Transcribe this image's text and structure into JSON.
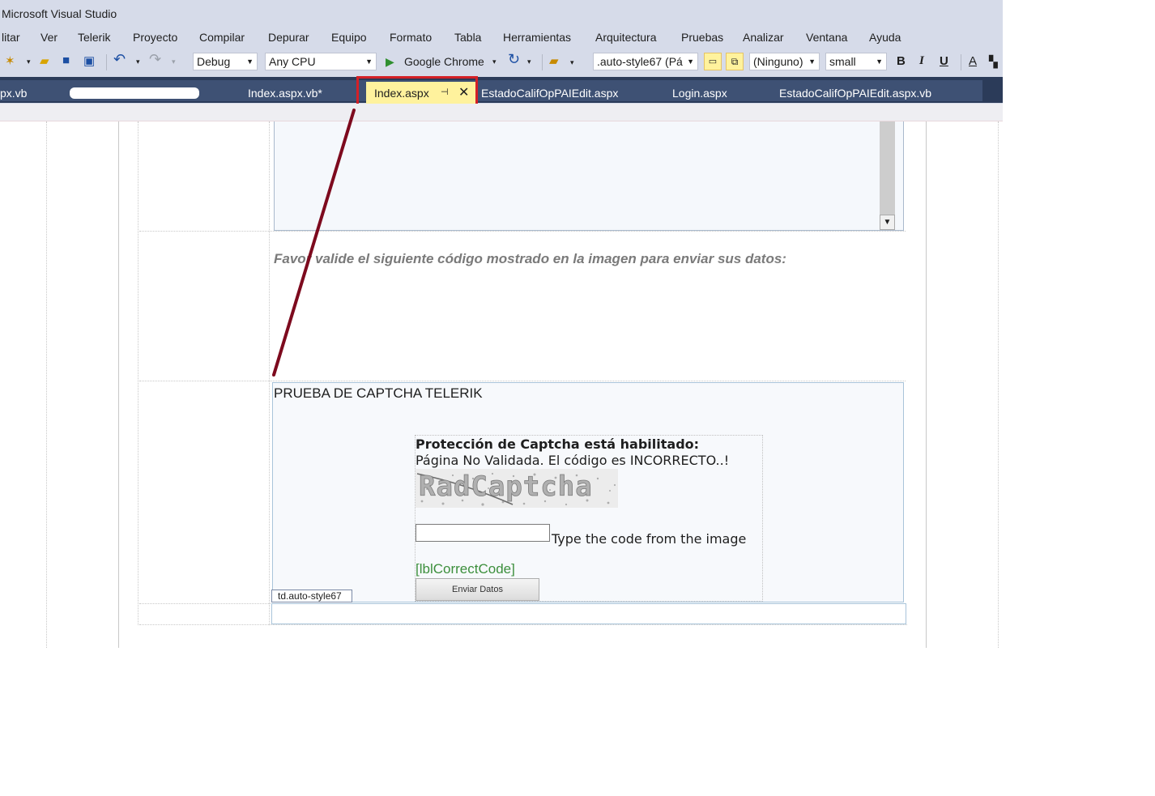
{
  "window": {
    "title": "Microsoft Visual Studio"
  },
  "menu": [
    "litar",
    "Ver",
    "Telerik",
    "Proyecto",
    "Compilar",
    "Depurar",
    "Equipo",
    "Formato",
    "Tabla",
    "Herramientas",
    "Arquitectura",
    "Pruebas",
    "Analizar",
    "Ventana",
    "Ayuda"
  ],
  "toolbar": {
    "config": "Debug",
    "platform": "Any CPU",
    "run_target": "Google Chrome",
    "style_target": ".auto-style67 (Pá",
    "font_name": "(Ninguno)",
    "font_size": "small",
    "bold": "B",
    "italic": "I",
    "underline": "U",
    "font_color": "A"
  },
  "tabs": [
    "px.vb",
    "Index.aspx.vb*",
    "EstadoCalifOpPAIEdit.aspx",
    "Login.aspx",
    "EstadoCalifOpPAIEdit.aspx.vb"
  ],
  "active_tab": {
    "label": "Index.aspx",
    "pin": "⊣",
    "close": "✕"
  },
  "design": {
    "validate_text": "Favor valide el siguiente código mostrado en la imagen para enviar sus datos:",
    "scroll_down": "▼",
    "captcha_section_title": "PRUEBA DE CAPTCHA TELERIK",
    "captcha": {
      "title": "Protección de Captcha está habilitado:",
      "error": "Página No Validada. El código es INCORRECTO..!",
      "image_text": "RadCaptcha",
      "input_value": "",
      "input_label": "Type the code from the image",
      "result_label": "[lblCorrectCode]",
      "submit": "Enviar Datos"
    },
    "selected_tag": "td.auto-style67"
  },
  "colors": {
    "accent": "#d42027",
    "active_tab": "#fff29d",
    "tabbar": "#3e5174",
    "annotation_line": "#7d0a1e"
  }
}
